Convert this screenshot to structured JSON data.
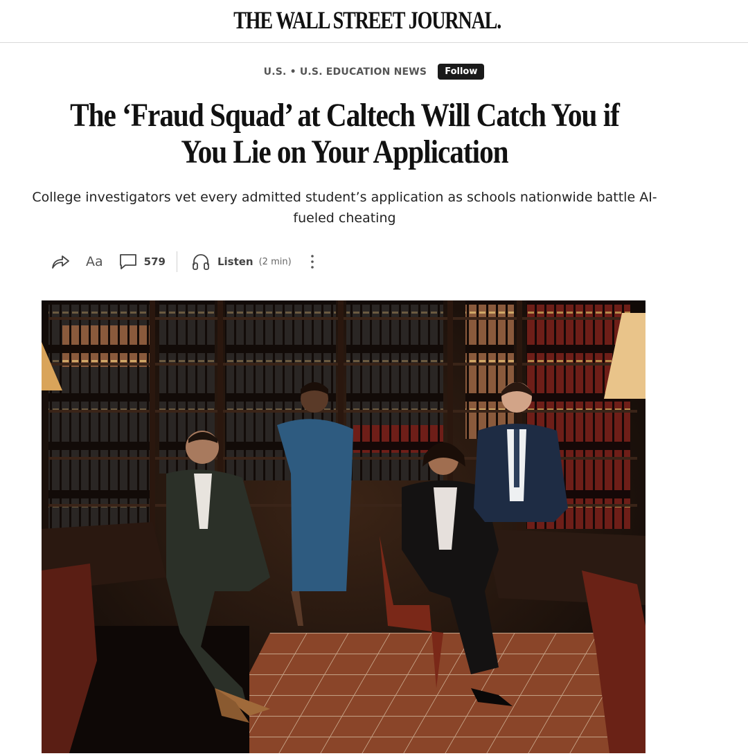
{
  "masthead": {
    "logo_text": "THE WALL STREET JOURNAL."
  },
  "article": {
    "breadcrumb": "U.S. • U.S. EDUCATION NEWS",
    "follow_label": "Follow",
    "headline": "The ‘Fraud Squad’ at Caltech Will Catch You if You Lie on Your Application",
    "dek": "College investigators vet every admitted student’s application as schools nationwide battle AI-fueled cheating"
  },
  "toolbar": {
    "share_icon": "share-arrow-icon",
    "text_size_label": "Aa",
    "comment_icon": "comment-icon",
    "comment_count": "579",
    "listen_icon": "headphones-icon",
    "listen_label": "Listen",
    "listen_duration": "(2 min)",
    "more_icon": "more-vertical-icon"
  },
  "colors": {
    "follow_bg": "#1a1a1a",
    "text": "#111111",
    "rule": "#d9d9d9"
  }
}
